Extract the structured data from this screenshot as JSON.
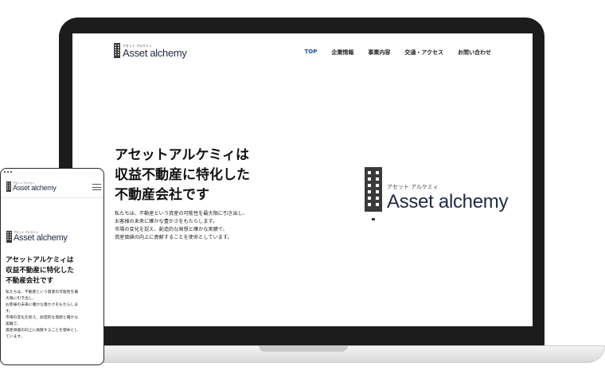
{
  "brand": {
    "kana": "アセット アルケミィ",
    "name": "Asset alchemy",
    "mark_icon": "building-icon"
  },
  "nav": {
    "items": [
      {
        "label": "TOP",
        "active": true
      },
      {
        "label": "企業情報",
        "active": false
      },
      {
        "label": "事業内容",
        "active": false
      },
      {
        "label": "交通・アクセス",
        "active": false
      },
      {
        "label": "お問い合わせ",
        "active": false
      }
    ]
  },
  "hero": {
    "title": "アセットアルケミィは\n収益不動産に特化した\n不動産会社です",
    "body": "私たちは、不動産という資産の可能性を最大限に引き出し、\nお客様の未来に確かな豊かさをもたらします。\n市場の変化を捉え、創造的な発想と確かな実績で、\n資産価値の向上に貢献することを使命としています。"
  },
  "mobile": {
    "title": "アセットアルケミィは\n収益不動産に特化した\n不動産会社です",
    "body": "私たちは、不動産という資産の可能性を最\n大限に引き出し、\nお客様の未来に確かな豊かさをもたらしま\nす。\n市場の変化を捉え、創造的な発想と確かな\n実績で、\n資産価値の向上に貢献することを使命とし\nています。",
    "menu_icon": "hamburger-menu-icon"
  },
  "colors": {
    "accent": "#1a4fa8",
    "logo_text": "#1f2a44",
    "device_frame": "#1c1c1c"
  }
}
